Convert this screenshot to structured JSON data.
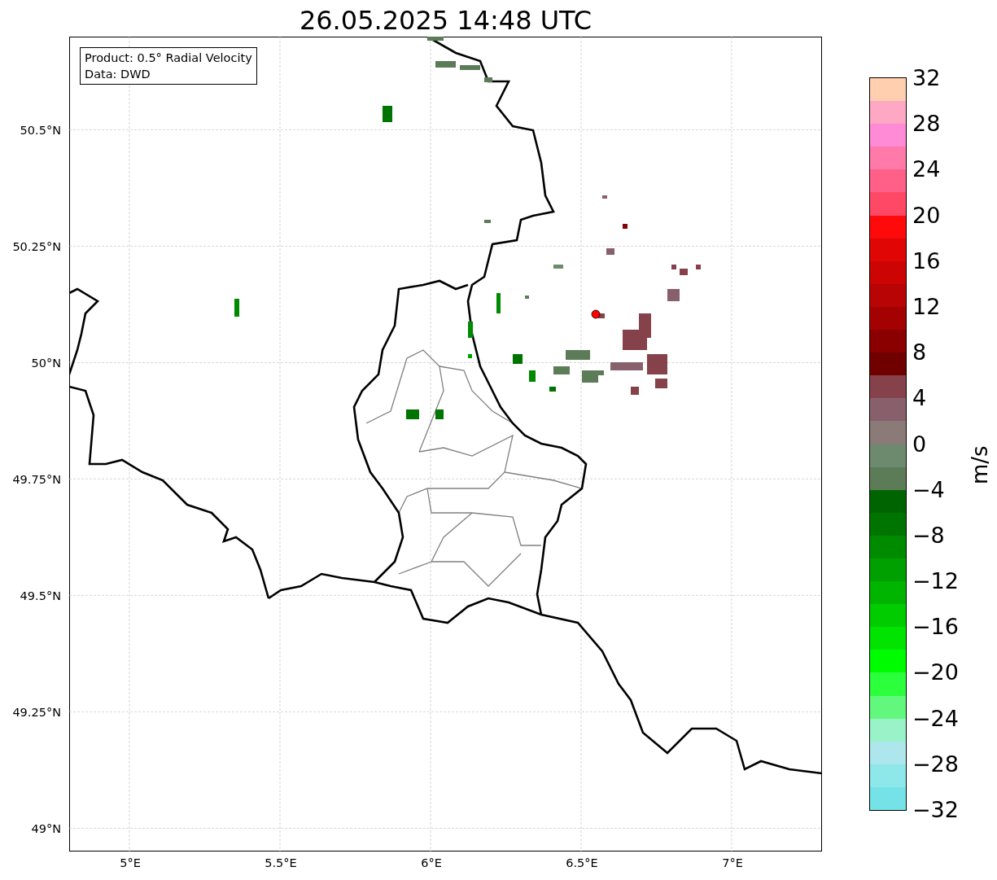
{
  "title": "26.05.2025 14:48 UTC",
  "map": {
    "info_lines": [
      "Product: 0.5° Radial Velocity",
      "Data: DWD"
    ],
    "lon_ticks": [
      "5°E",
      "5.5°E",
      "6°E",
      "6.5°E",
      "7°E"
    ],
    "lat_ticks": [
      "50.5°N",
      "50.25°N",
      "50°N",
      "49.75°N",
      "49.5°N",
      "49.25°N",
      "49°N"
    ]
  },
  "colorbar": {
    "label": "m/s",
    "ticks": [
      "32",
      "28",
      "24",
      "20",
      "16",
      "12",
      "8",
      "4",
      "0",
      "−4",
      "−8",
      "−12",
      "−16",
      "−20",
      "−24",
      "−28",
      "−32"
    ],
    "segments": [
      {
        "color": "#ffcfaf"
      },
      {
        "color": "#ffa8c4"
      },
      {
        "color": "#ff8ad6"
      },
      {
        "color": "#ff7aa8"
      },
      {
        "color": "#ff6088"
      },
      {
        "color": "#ff4866"
      },
      {
        "color": "#ff0a0a"
      },
      {
        "color": "#e00606"
      },
      {
        "color": "#cc0404"
      },
      {
        "color": "#b80404"
      },
      {
        "color": "#a40202"
      },
      {
        "color": "#8a0000"
      },
      {
        "color": "#700000"
      },
      {
        "color": "#86424a"
      },
      {
        "color": "#88606c"
      },
      {
        "color": "#8a7a78"
      },
      {
        "color": "#6e8a6e"
      },
      {
        "color": "#5c7c58"
      },
      {
        "color": "#006400"
      },
      {
        "color": "#007400"
      },
      {
        "color": "#008a00"
      },
      {
        "color": "#00a000"
      },
      {
        "color": "#00b400"
      },
      {
        "color": "#00cc00"
      },
      {
        "color": "#00e400"
      },
      {
        "color": "#00fc00"
      },
      {
        "color": "#2cff3c"
      },
      {
        "color": "#62f87e"
      },
      {
        "color": "#9af2c8"
      },
      {
        "color": "#aee6ee"
      },
      {
        "color": "#8ee8ea"
      },
      {
        "color": "#74e2e6"
      }
    ]
  }
}
